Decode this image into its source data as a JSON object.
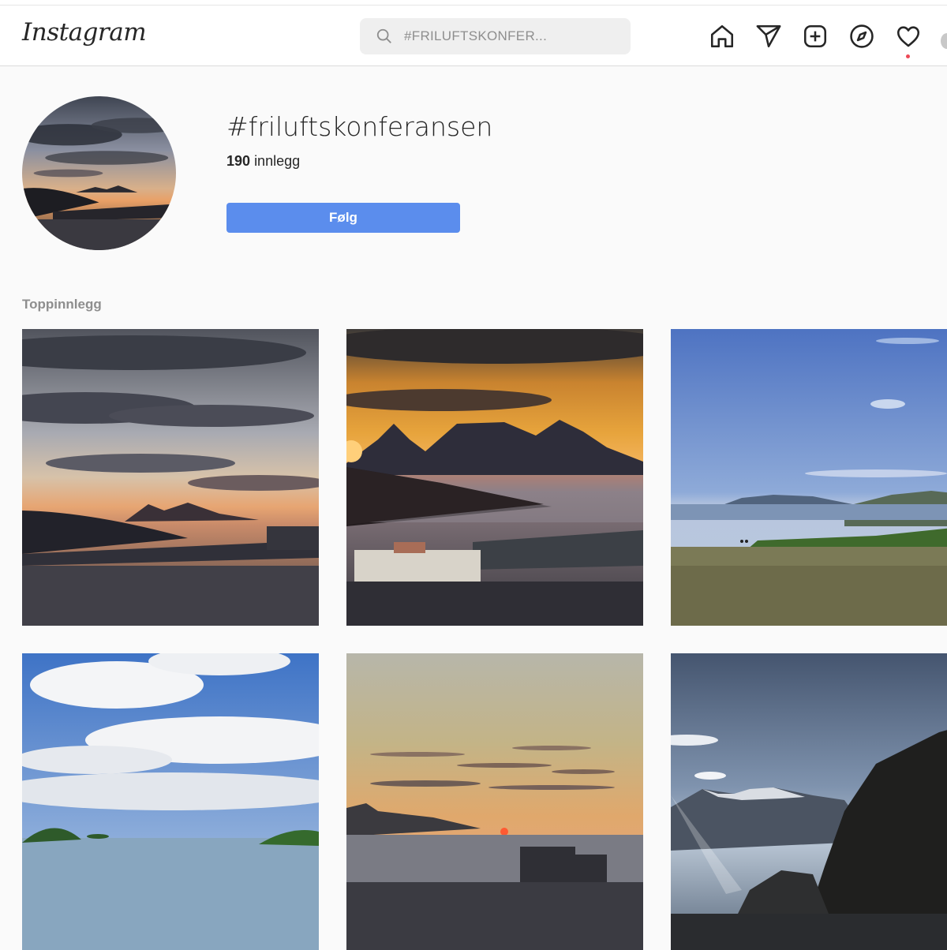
{
  "header": {
    "logo": "Instagram",
    "search_text": "#FRILUFTSKONFER..."
  },
  "nav": {
    "icons": [
      "home-icon",
      "direct-message-icon",
      "new-post-icon",
      "explore-icon",
      "activity-heart-icon"
    ],
    "notification_color": "#ed4956"
  },
  "tag": {
    "name": "#friluftskonferansen",
    "post_count": "190",
    "post_count_suffix": "innlegg",
    "follow_label": "Følg",
    "follow_color": "#5b8ded"
  },
  "section": {
    "title": "Toppinnlegg"
  },
  "posts": [
    {
      "scene": "sunset fjord with harbor"
    },
    {
      "scene": "orange sunset behind mountains and harbor"
    },
    {
      "scene": "mountain plateau with blue sky"
    },
    {
      "scene": "blue sky with clouds over sea"
    },
    {
      "scene": "golden sunset over water"
    },
    {
      "scene": "mountains with sun rays"
    }
  ]
}
